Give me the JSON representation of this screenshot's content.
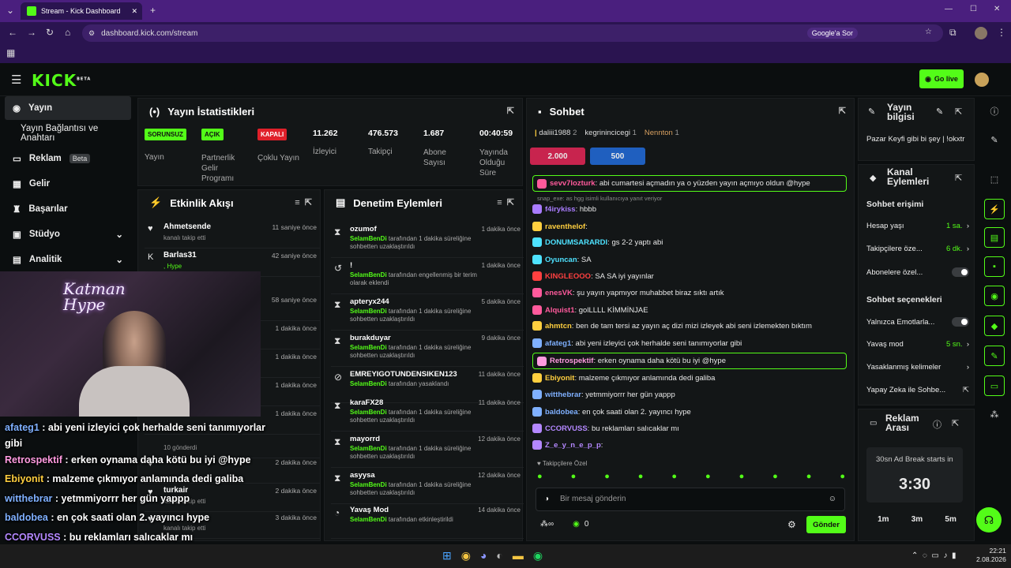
{
  "browser": {
    "tab_title": "Stream - Kick Dashboard",
    "url": "dashboard.kick.com/stream",
    "google_button": "Google'a Sor"
  },
  "topbar": {
    "logo": "KICK",
    "logo_badge": "BETA",
    "go_live": "Go live"
  },
  "nav": {
    "items": [
      "Yayın",
      "Yayın Bağlantısı ve Anahtarı",
      "Reklam",
      "Gelir",
      "Başarılar",
      "Stüdyo",
      "Analitik"
    ],
    "reklam_badge": "Beta"
  },
  "stats": {
    "title": "Yayın İstatistikleri",
    "cols": [
      {
        "pill": "SORUNSUZ",
        "label": "Yayın",
        "color": "#53fc18"
      },
      {
        "pill": "AÇIK",
        "label": "Partnerlik Gelir Programı",
        "color": "#53fc18"
      },
      {
        "pill": "KAPALI",
        "label": "Çoklu Yayın",
        "color": "#e0202a"
      },
      {
        "value": "11.262",
        "label": "İzleyici"
      },
      {
        "value": "476.573",
        "label": "Takipçi"
      },
      {
        "value": "1.687",
        "label": "Abone Sayısı"
      },
      {
        "value": "00:40:59",
        "label": "Yayında Olduğu Süre"
      }
    ]
  },
  "activity": {
    "title": "Etkinlik Akışı",
    "rows": [
      {
        "name": "Ahmetsende",
        "sub": "kanalı takip etti",
        "time": "11 saniye önce",
        "icon": "♥"
      },
      {
        "name": "Barlas31",
        "sub": ", Hype",
        "time": "42 saniye önce",
        "icon": "K"
      },
      {
        "name": "",
        "sub": "",
        "time": "58 saniye önce",
        "icon": ""
      },
      {
        "name": "",
        "sub": "",
        "time": "1 dakika önce",
        "icon": ""
      },
      {
        "name": "",
        "sub": "",
        "time": "1 dakika önce",
        "icon": ""
      },
      {
        "name": "",
        "sub": "",
        "time": "1 dakika önce",
        "icon": ""
      },
      {
        "name": "",
        "sub": "",
        "time": "1 dakika önce",
        "icon": ""
      },
      {
        "name": "",
        "sub": "10 gönderdi",
        "time": "",
        "icon": ""
      },
      {
        "name": "",
        "sub": "",
        "time": "2 dakika önce",
        "icon": "♥"
      },
      {
        "name": "turkair",
        "sub": "kanalı takip etti",
        "time": "2 dakika önce",
        "icon": "♥"
      },
      {
        "name": "",
        "sub": "kanalı takip etti",
        "time": "3 dakika önce",
        "icon": "♥"
      }
    ]
  },
  "moderation": {
    "title": "Denetim Eylemleri",
    "rows": [
      {
        "name": "ozumof",
        "mod": "SelamBenDi",
        "desc": " tarafından 1 dakika süreliğine sohbetten uzaklaştırıldı",
        "time": "1 dakika önce",
        "icon": "⧗"
      },
      {
        "name": "!",
        "mod": "SelamBenDi",
        "desc": " tarafından engellenmiş bir terim olarak eklendi",
        "time": "1 dakika önce",
        "icon": "↺"
      },
      {
        "name": "apteryx244",
        "mod": "SelamBenDi",
        "desc": " tarafından 1 dakika süreliğine sohbetten uzaklaştırıldı",
        "time": "5 dakika önce",
        "icon": "⧗"
      },
      {
        "name": "burakduyar",
        "mod": "SelamBenDi",
        "desc": " tarafından 1 dakika süreliğine sohbetten uzaklaştırıldı",
        "time": "9 dakika önce",
        "icon": "⧗"
      },
      {
        "name": "EMREYIGOTUNDENSIKEN123",
        "mod": "SelamBenDi",
        "desc": " tarafından yasaklandı",
        "time": "11 dakika önce",
        "icon": "⊘"
      },
      {
        "name": "karaFX28",
        "mod": "SelamBenDi",
        "desc": " tarafından 1 dakika süreliğine sohbetten uzaklaştırıldı",
        "time": "11 dakika önce",
        "icon": "⧗"
      },
      {
        "name": "mayorrd",
        "mod": "SelamBenDi",
        "desc": " tarafından 1 dakika süreliğine sohbetten uzaklaştırıldı",
        "time": "12 dakika önce",
        "icon": "⧗"
      },
      {
        "name": "asyysa",
        "mod": "SelamBenDi",
        "desc": " tarafından 1 dakika süreliğine sohbetten uzaklaştırıldı",
        "time": "12 dakika önce",
        "icon": "⧗"
      },
      {
        "name": "Yavaş Mod",
        "mod": "SelamBenDi",
        "desc": " tarafından etkinleştirildi",
        "time": "14 dakika önce",
        "icon": "◔"
      }
    ]
  },
  "chat": {
    "title": "Sohbet",
    "top_users": [
      {
        "name": "daliii1988",
        "count": "2"
      },
      {
        "name": "kegrinincicegi",
        "count": "1"
      },
      {
        "name": "Nennton",
        "count": "1"
      }
    ],
    "gifts": [
      "2.000",
      "500"
    ],
    "reply_hint": "snap_exe: as hgg isimli kullanıcıya yanıt veriyor",
    "messages": [
      {
        "user": "sevv7lozturk",
        "color": "#ff5a9c",
        "text": ": abi cumartesi açmadın ya o yüzden yayın açmıyo oldun @hype",
        "hl": true
      },
      {
        "user": "f4irykiss",
        "color": "#a97cff",
        "text": ": hbbb"
      },
      {
        "user": "raventhelof",
        "color": "#ffcf3f",
        "text": ":"
      },
      {
        "user": "DONUMSARARDI",
        "color": "#4ee2ff",
        "text": ": gs 2-2 yaptı abi"
      },
      {
        "user": "Oyuncan",
        "color": "#4ee2ff",
        "text": ": SA"
      },
      {
        "user": "KINGLEOOO",
        "color": "#ff4040",
        "text": ": SA SA iyi yayınlar"
      },
      {
        "user": "enesVK",
        "color": "#ff5a9c",
        "text": ": şu yayın yapmıyor muhabbet biraz sıktı artık"
      },
      {
        "user": "Alquist1",
        "color": "#ff5a9c",
        "text": ": golLLLL KİMMİNJAE"
      },
      {
        "user": "ahmtcn",
        "color": "#ffcf3f",
        "text": ": ben de tam tersi az yayın aç dizi mizi izleyek abi seni izlemekten bıktım"
      },
      {
        "user": "afateg1",
        "color": "#7fb0ff",
        "text": ": abi yeni izleyici çok herhalde seni tanımıyorlar gibi"
      },
      {
        "user": "Retrospektif",
        "color": "#ff9be0",
        "text": ": erken oynama daha kötü bu iyi @hype",
        "hl": true
      },
      {
        "user": "Ebiyonit",
        "color": "#ffcf3f",
        "text": ": malzeme çıkmıyor anlamında dedi galiba"
      },
      {
        "user": "witthebrar",
        "color": "#7fb0ff",
        "text": ": yetmmiyorrr her gün yappp"
      },
      {
        "user": "baldobea",
        "color": "#7fb0ff",
        "text": ": en çok saati olan 2. yayıncı hype"
      },
      {
        "user": "CCORVUSS",
        "color": "#b488ff",
        "text": ": bu reklamları salıcaklar mı"
      },
      {
        "user": "Z_e_y_n_e_p_p",
        "color": "#b488ff",
        "text": ":"
      }
    ],
    "follower_label": "Takipçilere Özel",
    "input_placeholder": "Bir mesaj gönderin",
    "points": "0",
    "send_label": "Gönder"
  },
  "stream_info": {
    "title": "Yayın bilgisi",
    "text": "Pazar Keyfi gibi bi şey | !okxtr"
  },
  "channel_actions": {
    "title": "Kanal Eylemleri",
    "chat_access": "Sohbet erişimi",
    "rows": [
      {
        "label": "Hesap yaşı",
        "value": "1 sa."
      },
      {
        "label": "Takipçilere öze...",
        "value": "6 dk."
      },
      {
        "label": "Abonelere özel...",
        "value": ""
      }
    ],
    "chat_options": "Sohbet seçenekleri",
    "rows2": [
      {
        "label": "Yalnızca Emotlarla...",
        "value": ""
      },
      {
        "label": "Yavaş mod",
        "value": "5 sn."
      },
      {
        "label": "Yasaklanmış kelimeler",
        "value": ""
      },
      {
        "label": "Yapay Zeka ile Sohbe...",
        "value": ""
      }
    ]
  },
  "ad_break": {
    "title": "Reklam Arası",
    "caption": "30sn Ad Break starts in",
    "countdown": "3:30",
    "options": [
      "1m",
      "3m",
      "5m"
    ]
  },
  "overlay": {
    "brand": "Katman Hype",
    "lines": [
      {
        "user": "afateg1",
        "text": " : abi yeni izleyici çok herhalde seni tanımıyorlar gibi",
        "color": "#7fb0ff"
      },
      {
        "user": "Retrospektif",
        "text": " : erken oynama daha kötü bu iyi @hype",
        "color": "#ff9be0"
      },
      {
        "user": "Ebiyonit",
        "text": " : malzeme çıkmıyor anlamında dedi galiba",
        "color": "#ffcf3f"
      },
      {
        "user": "witthebrar",
        "text": " : yetmmiyorrr her gün yappp",
        "color": "#7fb0ff"
      },
      {
        "user": "baldobea",
        "text": " : en çok saati olan 2. yayıncı hype",
        "color": "#7fb0ff"
      },
      {
        "user": "CCORVUSS",
        "text": " : bu reklamları salıcaklar mı",
        "color": "#b488ff"
      },
      {
        "user": "Z_e_y_n_e_p_p",
        "text": " :",
        "color": "#b488ff"
      }
    ]
  },
  "taskbar": {
    "time": "22:21",
    "date": "2.08.2026"
  }
}
